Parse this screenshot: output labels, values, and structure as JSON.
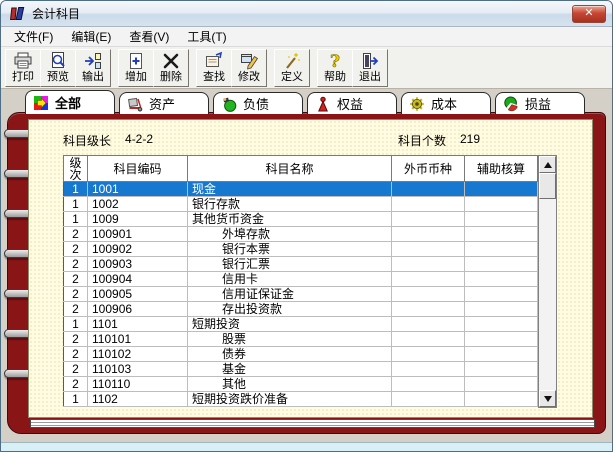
{
  "window": {
    "title": "会计科目",
    "close_glyph": "✕"
  },
  "menu": {
    "items": [
      {
        "label": "文件(F)"
      },
      {
        "label": "编辑(E)"
      },
      {
        "label": "查看(V)"
      },
      {
        "label": "工具(T)"
      }
    ]
  },
  "toolbar": {
    "buttons": [
      {
        "label": "打印",
        "icon": "printer-icon"
      },
      {
        "label": "预览",
        "icon": "preview-icon"
      },
      {
        "label": "输出",
        "icon": "export-icon"
      },
      {
        "label": "增加",
        "icon": "add-icon",
        "gap": true
      },
      {
        "label": "删除",
        "icon": "delete-icon"
      },
      {
        "label": "查找",
        "icon": "find-icon",
        "gap": true
      },
      {
        "label": "修改",
        "icon": "modify-icon"
      },
      {
        "label": "定义",
        "icon": "define-icon",
        "gap": true
      },
      {
        "label": "帮助",
        "icon": "help-icon",
        "gap": true
      },
      {
        "label": "退出",
        "icon": "exit-icon"
      }
    ]
  },
  "tabs": [
    {
      "label": "全部",
      "icon": "all-categories-icon",
      "active": true
    },
    {
      "label": "资产",
      "icon": "assets-icon"
    },
    {
      "label": "负债",
      "icon": "liabilities-icon"
    },
    {
      "label": "权益",
      "icon": "equity-icon"
    },
    {
      "label": "成本",
      "icon": "cost-icon"
    },
    {
      "label": "损益",
      "icon": "profit-loss-icon"
    }
  ],
  "summary": {
    "level_label": "科目级长",
    "level_value": "4-2-2",
    "count_label": "科目个数",
    "count_value": "219"
  },
  "table": {
    "columns": [
      "级次",
      "科目编码",
      "科目名称",
      "外币币种",
      "辅助核算"
    ],
    "rows": [
      {
        "level": "1",
        "code": "1001",
        "name": "现金",
        "currency": "",
        "aux": "",
        "selected": true
      },
      {
        "level": "1",
        "code": "1002",
        "name": "银行存款",
        "currency": "",
        "aux": ""
      },
      {
        "level": "1",
        "code": "1009",
        "name": "其他货币资金",
        "currency": "",
        "aux": ""
      },
      {
        "level": "2",
        "code": "100901",
        "name": "外埠存款",
        "currency": "",
        "aux": "",
        "indent": true
      },
      {
        "level": "2",
        "code": "100902",
        "name": "银行本票",
        "currency": "",
        "aux": "",
        "indent": true
      },
      {
        "level": "2",
        "code": "100903",
        "name": "银行汇票",
        "currency": "",
        "aux": "",
        "indent": true
      },
      {
        "level": "2",
        "code": "100904",
        "name": "信用卡",
        "currency": "",
        "aux": "",
        "indent": true
      },
      {
        "level": "2",
        "code": "100905",
        "name": "信用证保证金",
        "currency": "",
        "aux": "",
        "indent": true
      },
      {
        "level": "2",
        "code": "100906",
        "name": "存出投资款",
        "currency": "",
        "aux": "",
        "indent": true
      },
      {
        "level": "1",
        "code": "1101",
        "name": "短期投资",
        "currency": "",
        "aux": ""
      },
      {
        "level": "2",
        "code": "110101",
        "name": "股票",
        "currency": "",
        "aux": "",
        "indent": true
      },
      {
        "level": "2",
        "code": "110102",
        "name": "债券",
        "currency": "",
        "aux": "",
        "indent": true
      },
      {
        "level": "2",
        "code": "110103",
        "name": "基金",
        "currency": "",
        "aux": "",
        "indent": true
      },
      {
        "level": "2",
        "code": "110110",
        "name": "其他",
        "currency": "",
        "aux": "",
        "indent": true
      },
      {
        "level": "1",
        "code": "1102",
        "name": "短期投资跌价准备",
        "currency": "",
        "aux": ""
      }
    ]
  },
  "colors": {
    "cover": "#8A1517",
    "page": "#FFFCE1",
    "selection": "#1778D0",
    "close_button": "#C74634"
  }
}
